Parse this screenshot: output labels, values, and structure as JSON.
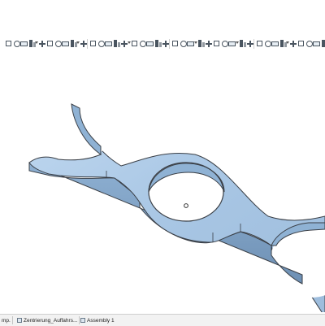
{
  "toolbar": {
    "icons": [
      "sketch-icon",
      "extrude-icon",
      "revolve-icon",
      "sweep-icon",
      "loft-icon",
      "feature-icon",
      "cut-icon",
      "fillet-icon",
      "chamfer-icon",
      "draft-icon",
      "shell-icon",
      "pattern-icon",
      "mirror-icon",
      "rib-icon",
      "hole-icon",
      "wrap-icon",
      "dome-icon",
      "split-icon",
      "combine-icon",
      "move-body-icon",
      "reference-plane-icon",
      "axis-icon",
      "point-icon",
      "coordinate-system-icon",
      "curve-icon",
      "surface-icon",
      "knit-icon",
      "measure-icon",
      "mass-properties-icon",
      "section-view-icon",
      "display-icon",
      "view-orientation-icon",
      "zoom-icon",
      "rotate-icon",
      "equations-icon",
      "render-icon",
      "appearance-icon",
      "scene-icon",
      "settings-icon",
      "options-icon"
    ]
  },
  "tabs": [
    {
      "label": "mp."
    },
    {
      "label": "Zentrierung_Auffahrs..."
    },
    {
      "label": "Assembly 1"
    }
  ],
  "colors": {
    "part_top": "#aac8e6",
    "part_side": "#7fa0c2",
    "part_edge": "#3a3f46",
    "toolbar_icon": "#4a5560"
  }
}
